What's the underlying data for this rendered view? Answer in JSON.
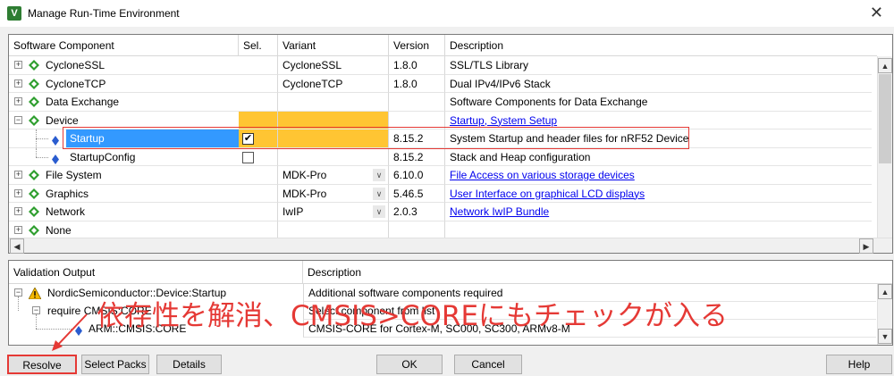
{
  "window": {
    "title": "Manage Run-Time Environment",
    "close_glyph": "✕"
  },
  "components": {
    "headers": {
      "component": "Software Component",
      "sel": "Sel.",
      "variant": "Variant",
      "version": "Version",
      "description": "Description"
    },
    "rows": [
      {
        "name": "CycloneSSL",
        "variant": "CycloneSSL",
        "version": "1.8.0",
        "description": "SSL/TLS Library",
        "link": false
      },
      {
        "name": "CycloneTCP",
        "variant": "CycloneTCP",
        "version": "1.8.0",
        "description": "Dual IPv4/IPv6 Stack",
        "link": false
      },
      {
        "name": "Data Exchange",
        "variant": "",
        "version": "",
        "description": "Software Components for Data Exchange",
        "link": false
      },
      {
        "name": "Device",
        "variant": "",
        "version": "",
        "description": "Startup, System Setup",
        "link": true
      },
      {
        "name": "Startup",
        "variant": "",
        "version": "8.15.2",
        "description": "System Startup and header files for nRF52 Device",
        "link": false,
        "checked": true
      },
      {
        "name": "StartupConfig",
        "variant": "",
        "version": "8.15.2",
        "description": "Stack and Heap configuration",
        "link": false
      },
      {
        "name": "File System",
        "variant": "MDK-Pro",
        "version": "6.10.0",
        "description": "File Access on various storage devices",
        "link": true
      },
      {
        "name": "Graphics",
        "variant": "MDK-Pro",
        "version": "5.46.5",
        "description": "User Interface on graphical LCD displays",
        "link": true
      },
      {
        "name": "Network",
        "variant": "IwIP",
        "version": "2.0.3",
        "description": "Network IwIP Bundle",
        "link": true
      },
      {
        "name": "None",
        "variant": "",
        "version": "",
        "description": "",
        "link": false
      }
    ],
    "check_glyph": "✔"
  },
  "validation": {
    "headers": {
      "output": "Validation Output",
      "description": "Description"
    },
    "rows": [
      {
        "text": "NordicSemiconductor::Device:Startup",
        "description": "Additional software components required"
      },
      {
        "text": "require CMSIS:CORE",
        "description": "Select component from list"
      },
      {
        "text": "ARM::CMSIS:CORE",
        "description": "CMSIS-CORE for Cortex-M, SC000, SC300, ARMv8-M"
      }
    ]
  },
  "buttons": {
    "resolve": "Resolve",
    "select_packs": "Select Packs",
    "details": "Details",
    "ok": "OK",
    "cancel": "Cancel",
    "help": "Help"
  },
  "annotation": {
    "text": "依存性を解消、CMSIS>COREにもチェックが入る",
    "color": "#e53935"
  },
  "colors": {
    "selection": "#3399ff",
    "required": "#ffc533",
    "link": "#0000ee",
    "gem": "#2e9e2e"
  }
}
